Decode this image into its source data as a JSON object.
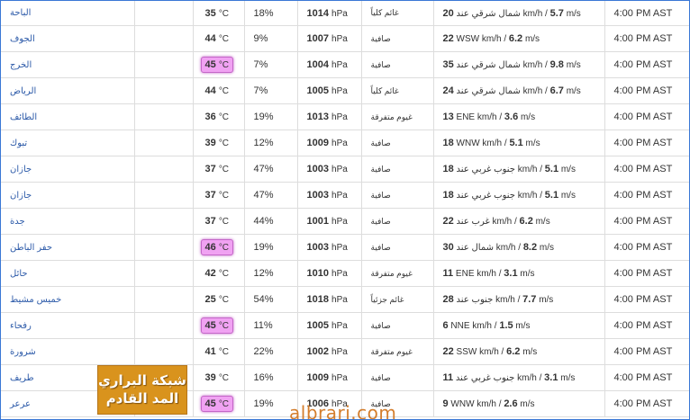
{
  "colors": {
    "frame_border": "#3a78d6",
    "city_text": "#2b59a8",
    "hot_highlight": "#f0a2f2",
    "logo_background": "#d9931d",
    "watermark": "#d47e2d"
  },
  "units": {
    "temperature": "°C",
    "pressure": "hPa",
    "wind_speed_kmh": "km/h",
    "wind_speed_ms": "m/s",
    "separator": "/"
  },
  "rows": [
    {
      "city": "الباحة",
      "temp": "35",
      "hot": false,
      "humidity": "18%",
      "pressure": "1014",
      "condition": "غائم كلياً",
      "wind_dir": "شمال شرقي عند",
      "wind_kmh": "20",
      "wind_ms": "5.7",
      "time": "4:00 PM AST"
    },
    {
      "city": "الجوف",
      "temp": "44",
      "hot": false,
      "humidity": "9%",
      "pressure": "1007",
      "condition": "صافية",
      "wind_dir": "WSW",
      "wind_kmh": "22",
      "wind_ms": "6.2",
      "time": "4:00 PM AST"
    },
    {
      "city": "الخرج",
      "temp": "45",
      "hot": true,
      "humidity": "7%",
      "pressure": "1004",
      "condition": "صافية",
      "wind_dir": "شمال شرقي عند",
      "wind_kmh": "35",
      "wind_ms": "9.8",
      "time": "4:00 PM AST"
    },
    {
      "city": "الرياض",
      "temp": "44",
      "hot": false,
      "humidity": "7%",
      "pressure": "1005",
      "condition": "غائم كلياً",
      "wind_dir": "شمال شرقي عند",
      "wind_kmh": "24",
      "wind_ms": "6.7",
      "time": "4:00 PM AST"
    },
    {
      "city": "الطائف",
      "temp": "36",
      "hot": false,
      "humidity": "19%",
      "pressure": "1013",
      "condition": "غيوم متفرقة",
      "wind_dir": "ENE",
      "wind_kmh": "13",
      "wind_ms": "3.6",
      "time": "4:00 PM AST"
    },
    {
      "city": "تبوك",
      "temp": "39",
      "hot": false,
      "humidity": "12%",
      "pressure": "1009",
      "condition": "صافية",
      "wind_dir": "WNW",
      "wind_kmh": "18",
      "wind_ms": "5.1",
      "time": "4:00 PM AST"
    },
    {
      "city": "جازان",
      "temp": "37",
      "hot": false,
      "humidity": "47%",
      "pressure": "1003",
      "condition": "صافية",
      "wind_dir": "جنوب غربي عند",
      "wind_kmh": "18",
      "wind_ms": "5.1",
      "time": "4:00 PM AST"
    },
    {
      "city": "جازان",
      "temp": "37",
      "hot": false,
      "humidity": "47%",
      "pressure": "1003",
      "condition": "صافية",
      "wind_dir": "جنوب غربي عند",
      "wind_kmh": "18",
      "wind_ms": "5.1",
      "time": "4:00 PM AST"
    },
    {
      "city": "جدة",
      "temp": "37",
      "hot": false,
      "humidity": "44%",
      "pressure": "1001",
      "condition": "صافية",
      "wind_dir": "غرب عند",
      "wind_kmh": "22",
      "wind_ms": "6.2",
      "time": "4:00 PM AST"
    },
    {
      "city": "حفر الباطن",
      "temp": "46",
      "hot": true,
      "humidity": "19%",
      "pressure": "1003",
      "condition": "صافية",
      "wind_dir": "شمال عند",
      "wind_kmh": "30",
      "wind_ms": "8.2",
      "time": "4:00 PM AST"
    },
    {
      "city": "حائل",
      "temp": "42",
      "hot": false,
      "humidity": "12%",
      "pressure": "1010",
      "condition": "غيوم متفرقة",
      "wind_dir": "ENE",
      "wind_kmh": "11",
      "wind_ms": "3.1",
      "time": "4:00 PM AST"
    },
    {
      "city": "خميس مشيط",
      "temp": "25",
      "hot": false,
      "humidity": "54%",
      "pressure": "1018",
      "condition": "غائم جزئياً",
      "wind_dir": "جنوب عند",
      "wind_kmh": "28",
      "wind_ms": "7.7",
      "time": "4:00 PM AST"
    },
    {
      "city": "رفحاء",
      "temp": "45",
      "hot": true,
      "humidity": "11%",
      "pressure": "1005",
      "condition": "صافية",
      "wind_dir": "NNE",
      "wind_kmh": "6",
      "wind_ms": "1.5",
      "time": "4:00 PM AST"
    },
    {
      "city": "شرورة",
      "temp": "41",
      "hot": false,
      "humidity": "22%",
      "pressure": "1002",
      "condition": "غيوم متفرقة",
      "wind_dir": "SSW",
      "wind_kmh": "22",
      "wind_ms": "6.2",
      "time": "4:00 PM AST"
    },
    {
      "city": "طريف",
      "temp": "39",
      "hot": false,
      "humidity": "16%",
      "pressure": "1009",
      "condition": "صافية",
      "wind_dir": "جنوب غربي عند",
      "wind_kmh": "11",
      "wind_ms": "3.1",
      "time": "4:00 PM AST"
    },
    {
      "city": "عرعر",
      "temp": "45",
      "hot": true,
      "humidity": "19%",
      "pressure": "1006",
      "condition": "صافية",
      "wind_dir": "WNW",
      "wind_kmh": "9",
      "wind_ms": "2.6",
      "time": "4:00 PM AST"
    }
  ],
  "logo": {
    "line1": "شبكة البراري",
    "line2": "المد القادم"
  },
  "watermark": {
    "text": "albrari.com"
  }
}
